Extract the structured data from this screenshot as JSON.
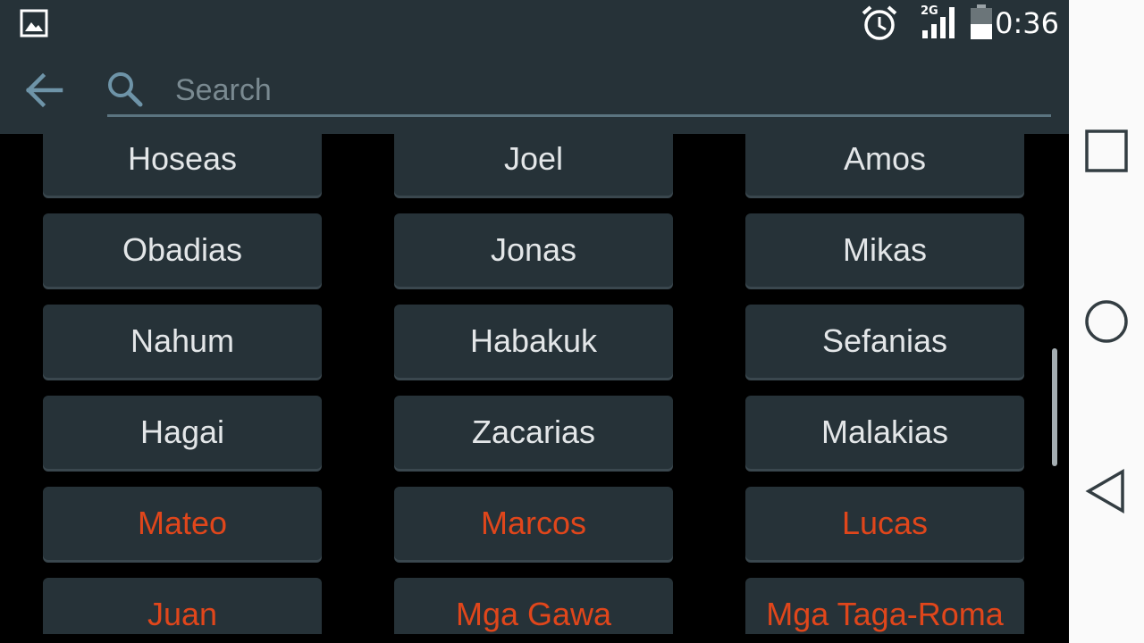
{
  "status_bar": {
    "time": "0:36",
    "network_label": "2G",
    "icons": [
      "image-icon",
      "alarm-icon",
      "signal-icon",
      "battery-icon"
    ]
  },
  "toolbar": {
    "search_placeholder": "Search",
    "search_value": ""
  },
  "books": {
    "rows": [
      [
        {
          "label": "Hoseas",
          "testament": "old"
        },
        {
          "label": "Joel",
          "testament": "old"
        },
        {
          "label": "Amos",
          "testament": "old"
        }
      ],
      [
        {
          "label": "Obadias",
          "testament": "old"
        },
        {
          "label": "Jonas",
          "testament": "old"
        },
        {
          "label": "Mikas",
          "testament": "old"
        }
      ],
      [
        {
          "label": "Nahum",
          "testament": "old"
        },
        {
          "label": "Habakuk",
          "testament": "old"
        },
        {
          "label": "Sefanias",
          "testament": "old"
        }
      ],
      [
        {
          "label": "Hagai",
          "testament": "old"
        },
        {
          "label": "Zacarias",
          "testament": "old"
        },
        {
          "label": "Malakias",
          "testament": "old"
        }
      ],
      [
        {
          "label": "Mateo",
          "testament": "new"
        },
        {
          "label": "Marcos",
          "testament": "new"
        },
        {
          "label": "Lucas",
          "testament": "new"
        }
      ],
      [
        {
          "label": "Juan",
          "testament": "new"
        },
        {
          "label": "Mga Gawa",
          "testament": "new"
        },
        {
          "label": "Mga Taga-Roma",
          "testament": "new"
        }
      ]
    ]
  },
  "colors": {
    "toolbar_bg": "#263238",
    "old_testament_text": "#e3e6e8",
    "new_testament_text": "#e0461b"
  }
}
